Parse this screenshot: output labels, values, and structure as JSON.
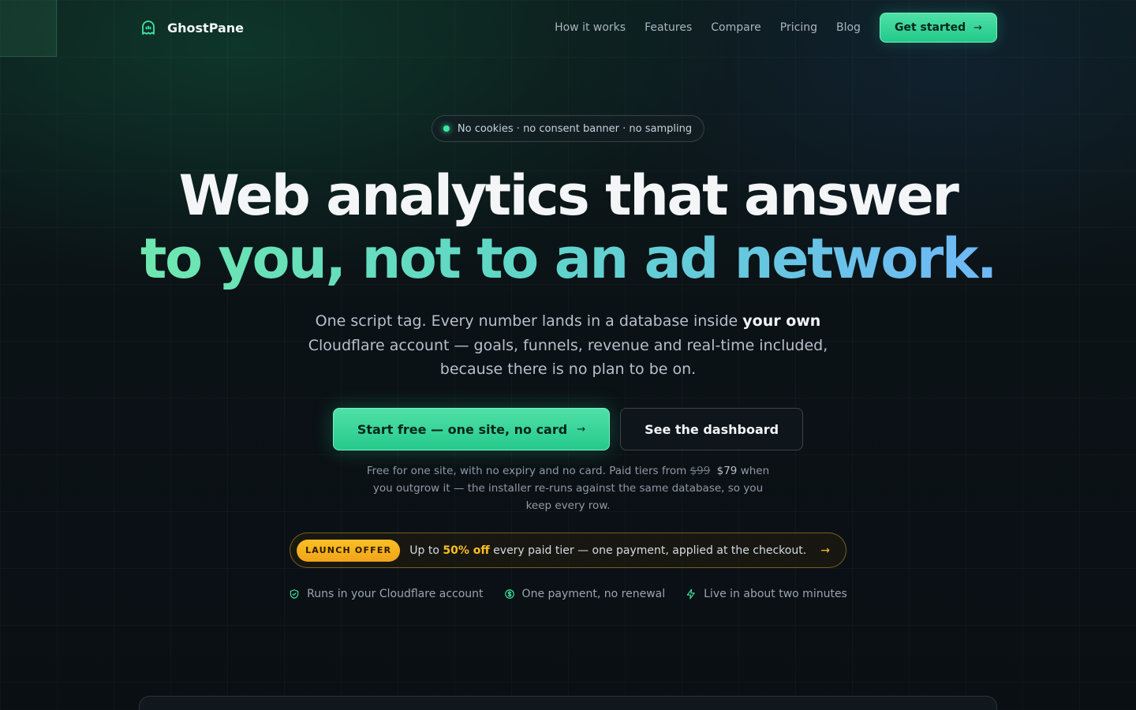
{
  "brand": {
    "name": "GhostPane",
    "icon": "ghost-icon",
    "accent": "#3ee6a0"
  },
  "nav": {
    "links": [
      "How it works",
      "Features",
      "Compare",
      "Pricing",
      "Blog"
    ],
    "cta_label": "Get started",
    "cta_arrow": "→"
  },
  "hero": {
    "pill": "No cookies · no consent banner · no sampling",
    "headline_line1": "Web analytics that answer",
    "headline_line2": "to you, not to an ad network.",
    "sub_part1": "One script tag. Every number lands in a database inside ",
    "sub_bold": "your own",
    "sub_part2": " Cloudflare account — goals, funnels, revenue and real-time included, because there is no plan to be on."
  },
  "cta": {
    "primary_label": "Start free — one site, no card",
    "primary_arrow": "→",
    "secondary_label": "See the dashboard"
  },
  "fine_print": {
    "part1": "Free for one site, with no expiry and no card. Paid tiers from ",
    "old_price": "$99",
    "new_price": "$79",
    "part2": " when you outgrow it — the installer re-runs against the same database, so you keep every row."
  },
  "offer": {
    "badge": "LAUNCH OFFER",
    "text_before": "Up to ",
    "highlight": "50% off",
    "text_after": " every paid tier — one payment, applied at the checkout.",
    "arrow": "→",
    "accent": "#fbbf24"
  },
  "trust": [
    {
      "icon": "shield-check-icon",
      "label": "Runs in your Cloudflare account"
    },
    {
      "icon": "dollar-circle-icon",
      "label": "One payment, no renewal"
    },
    {
      "icon": "lightning-icon",
      "label": "Live in about two minutes"
    }
  ]
}
